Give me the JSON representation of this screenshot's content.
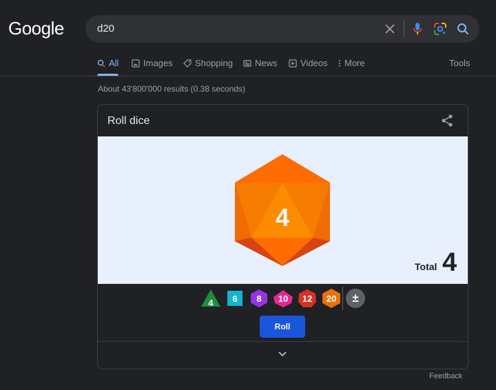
{
  "header": {
    "logo": "Google",
    "query": "d20",
    "icons": [
      "close-icon",
      "mic-icon",
      "lens-icon",
      "search-icon"
    ]
  },
  "tabs": [
    {
      "label": "All",
      "icon": "search-icon",
      "active": true
    },
    {
      "label": "Images",
      "icon": "image-icon"
    },
    {
      "label": "Shopping",
      "icon": "tag-icon"
    },
    {
      "label": "News",
      "icon": "news-icon"
    },
    {
      "label": "Videos",
      "icon": "play-icon"
    },
    {
      "label": "More",
      "icon": "more-vert-icon"
    }
  ],
  "tools_label": "Tools",
  "stats": "About 43'800'000 results (0.38 seconds)",
  "card": {
    "title": "Roll dice",
    "rolled_value": "4",
    "total_label": "Total",
    "total_value": "4",
    "dice": [
      {
        "label": "4",
        "color": "#1e8e3e"
      },
      {
        "label": "6",
        "color": "#12b5cb"
      },
      {
        "label": "8",
        "color": "#9334e6"
      },
      {
        "label": "10",
        "color": "#e52592"
      },
      {
        "label": "12",
        "color": "#d93025"
      },
      {
        "label": "20",
        "color": "#e8710a"
      },
      {
        "label": "±",
        "color": "#5f6368"
      }
    ],
    "roll_label": "Roll"
  },
  "feedback": "Feedback"
}
